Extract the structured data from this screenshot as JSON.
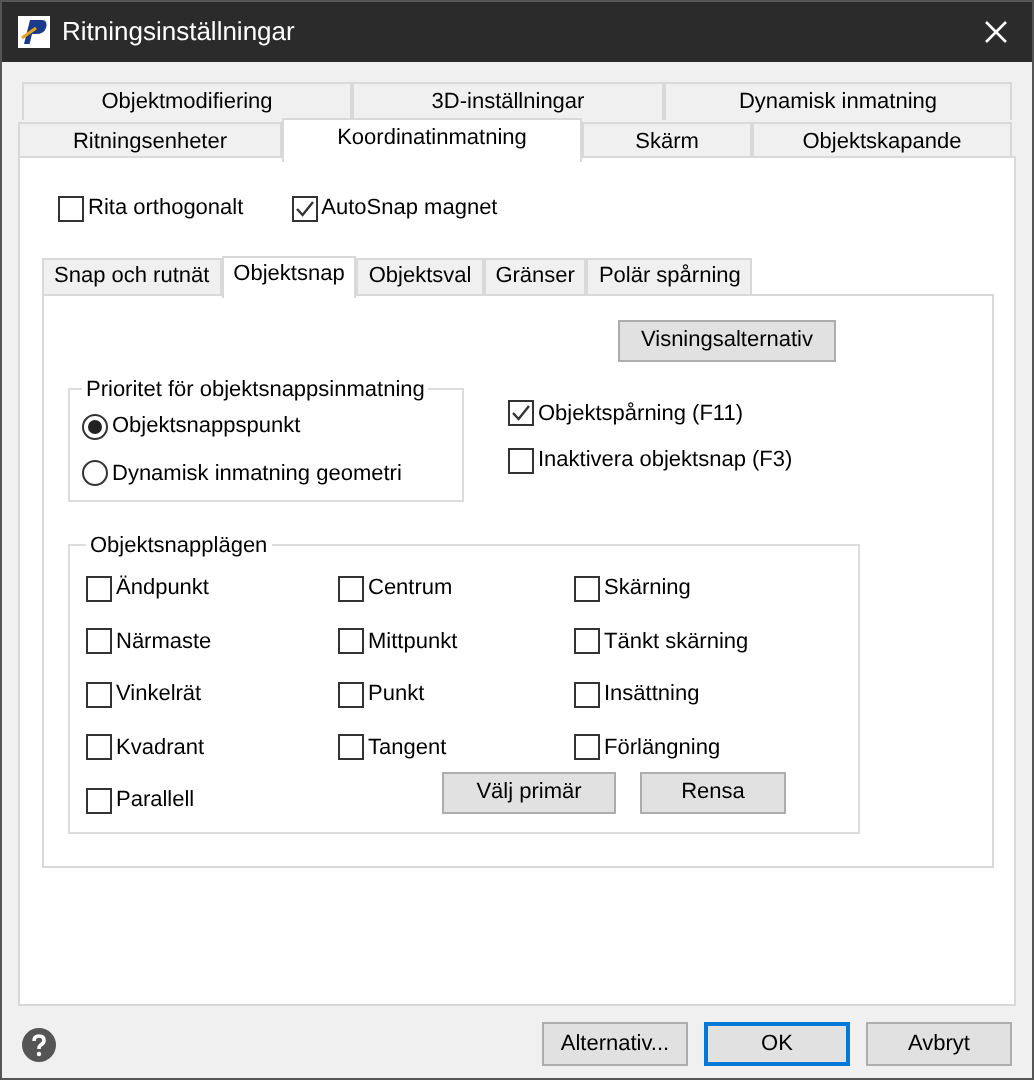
{
  "window": {
    "title": "Ritningsinställningar"
  },
  "tab_rows": [
    [
      {
        "label": "Objektmodifiering",
        "selected": false
      },
      {
        "label": "3D-inställningar",
        "selected": false
      },
      {
        "label": "Dynamisk inmatning",
        "selected": false
      }
    ],
    [
      {
        "label": "Ritningsenheter",
        "selected": false
      },
      {
        "label": "Koordinatinmatning",
        "selected": true
      },
      {
        "label": "Skärm",
        "selected": false
      },
      {
        "label": "Objektskapande",
        "selected": false
      }
    ]
  ],
  "top_options": [
    {
      "label": "Rita orthogonalt",
      "checked": false
    },
    {
      "label": "AutoSnap magnet",
      "checked": true
    }
  ],
  "inner_tabs": [
    {
      "label": "Snap och rutnät",
      "selected": false
    },
    {
      "label": "Objektsnap",
      "selected": true
    },
    {
      "label": "Objektsval",
      "selected": false
    },
    {
      "label": "Gränser",
      "selected": false
    },
    {
      "label": "Polär spårning",
      "selected": false
    }
  ],
  "display_button": "Visningsalternativ",
  "priority_group": {
    "title": "Prioritet för objektsnappsinmatning",
    "options": [
      {
        "label": "Objektsnappspunkt",
        "selected": true
      },
      {
        "label": "Dynamisk inmatning geometri",
        "selected": false
      }
    ]
  },
  "tracking_options": [
    {
      "label": "Objektspårning (F11)",
      "checked": true
    },
    {
      "label": "Inaktivera objektsnap (F3)",
      "checked": false
    }
  ],
  "snap_modes_group": {
    "title": "Objektsnapplägen",
    "modes": [
      {
        "label": "Ändpunkt",
        "checked": false
      },
      {
        "label": "Centrum",
        "checked": false
      },
      {
        "label": "Skärning",
        "checked": false
      },
      {
        "label": "Närmaste",
        "checked": false
      },
      {
        "label": "Mittpunkt",
        "checked": false
      },
      {
        "label": "Tänkt skärning",
        "checked": false
      },
      {
        "label": "Vinkelrät",
        "checked": false
      },
      {
        "label": "Punkt",
        "checked": false
      },
      {
        "label": "Insättning",
        "checked": false
      },
      {
        "label": "Kvadrant",
        "checked": false
      },
      {
        "label": "Tangent",
        "checked": false
      },
      {
        "label": "Förlängning",
        "checked": false
      },
      {
        "label": "Parallell",
        "checked": false
      }
    ],
    "buttons": [
      "Välj primär",
      "Rensa"
    ]
  },
  "dialog_buttons": [
    {
      "label": "Alternativ...",
      "default": false
    },
    {
      "label": "OK",
      "default": true
    },
    {
      "label": "Avbryt",
      "default": false
    }
  ]
}
